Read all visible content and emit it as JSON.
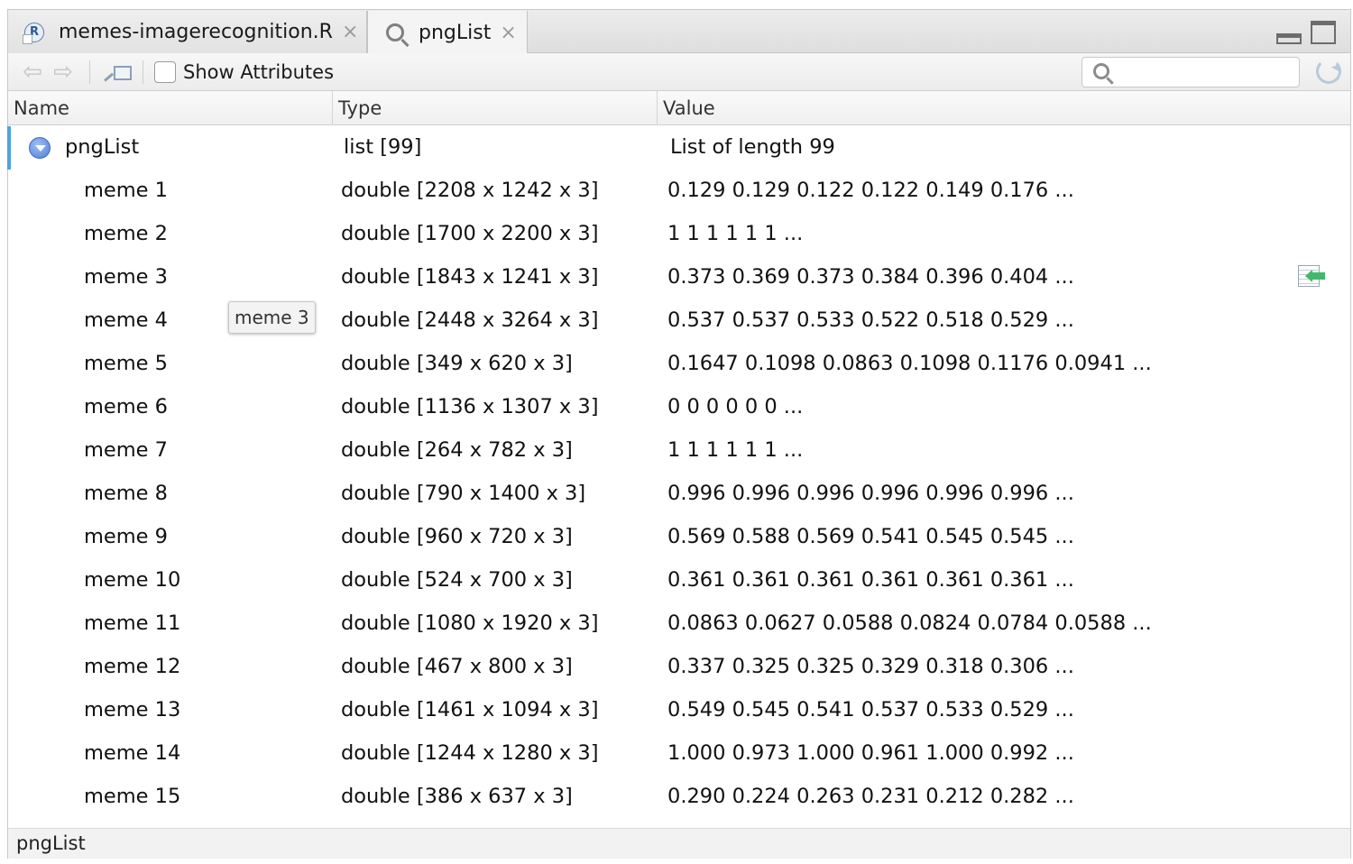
{
  "tabs": [
    {
      "label": "memes-imagerecognition.R",
      "icon": "r-file-icon",
      "close": "×"
    },
    {
      "label": "pngList",
      "icon": "search-icon",
      "close": "×"
    }
  ],
  "toolbar": {
    "back": "⇦",
    "forward": "⇨",
    "show_attributes_label": "Show Attributes",
    "show_attributes_checked": false,
    "search_placeholder": "",
    "search_value": ""
  },
  "columns": {
    "name": "Name",
    "type": "Type",
    "value": "Value"
  },
  "root": {
    "name": "pngList",
    "type": "list [99]",
    "value": "List of length 99",
    "expanded": true
  },
  "rows": [
    {
      "name": "meme 1",
      "type": "double [2208 x 1242 x 3]",
      "value": "0.129 0.129 0.122 0.122 0.149 0.176 ..."
    },
    {
      "name": "meme 2",
      "type": "double [1700 x 2200 x 3]",
      "value": "1 1 1 1 1 1 ..."
    },
    {
      "name": "meme 3",
      "type": "double [1843 x 1241 x 3]",
      "value": "0.373 0.369 0.373 0.384 0.396 0.404 ..."
    },
    {
      "name": "meme 4",
      "type": "double [2448 x 3264 x 3]",
      "value": "0.537 0.537 0.533 0.522 0.518 0.529 ..."
    },
    {
      "name": "meme 5",
      "type": "double [349 x 620 x 3]",
      "value": "0.1647 0.1098 0.0863 0.1098 0.1176 0.0941 ..."
    },
    {
      "name": "meme 6",
      "type": "double [1136 x 1307 x 3]",
      "value": "0 0 0 0 0 0 ..."
    },
    {
      "name": "meme 7",
      "type": "double [264 x 782 x 3]",
      "value": "1 1 1 1 1 1 ..."
    },
    {
      "name": "meme 8",
      "type": "double [790 x 1400 x 3]",
      "value": "0.996 0.996 0.996 0.996 0.996 0.996 ..."
    },
    {
      "name": "meme 9",
      "type": "double [960 x 720 x 3]",
      "value": "0.569 0.588 0.569 0.541 0.545 0.545 ..."
    },
    {
      "name": "meme 10",
      "type": "double [524 x 700 x 3]",
      "value": "0.361 0.361 0.361 0.361 0.361 0.361 ..."
    },
    {
      "name": "meme 11",
      "type": "double [1080 x 1920 x 3]",
      "value": "0.0863 0.0627 0.0588 0.0824 0.0784 0.0588 ..."
    },
    {
      "name": "meme 12",
      "type": "double [467 x 800 x 3]",
      "value": "0.337 0.325 0.325 0.329 0.318 0.306 ..."
    },
    {
      "name": "meme 13",
      "type": "double [1461 x 1094 x 3]",
      "value": "0.549 0.545 0.541 0.537 0.533 0.529 ..."
    },
    {
      "name": "meme 14",
      "type": "double [1244 x 1280 x 3]",
      "value": "1.000 0.973 1.000 0.961 1.000 0.992 ..."
    },
    {
      "name": "meme 15",
      "type": "double [386 x 637 x 3]",
      "value": "0.290 0.224 0.263 0.231 0.212 0.282 ..."
    }
  ],
  "tooltip": "meme 3",
  "statusbar": "pngList",
  "colors": {
    "accent": "#4da3e0",
    "expand": "#4f7fd6",
    "view_arrow": "#42b86a"
  }
}
